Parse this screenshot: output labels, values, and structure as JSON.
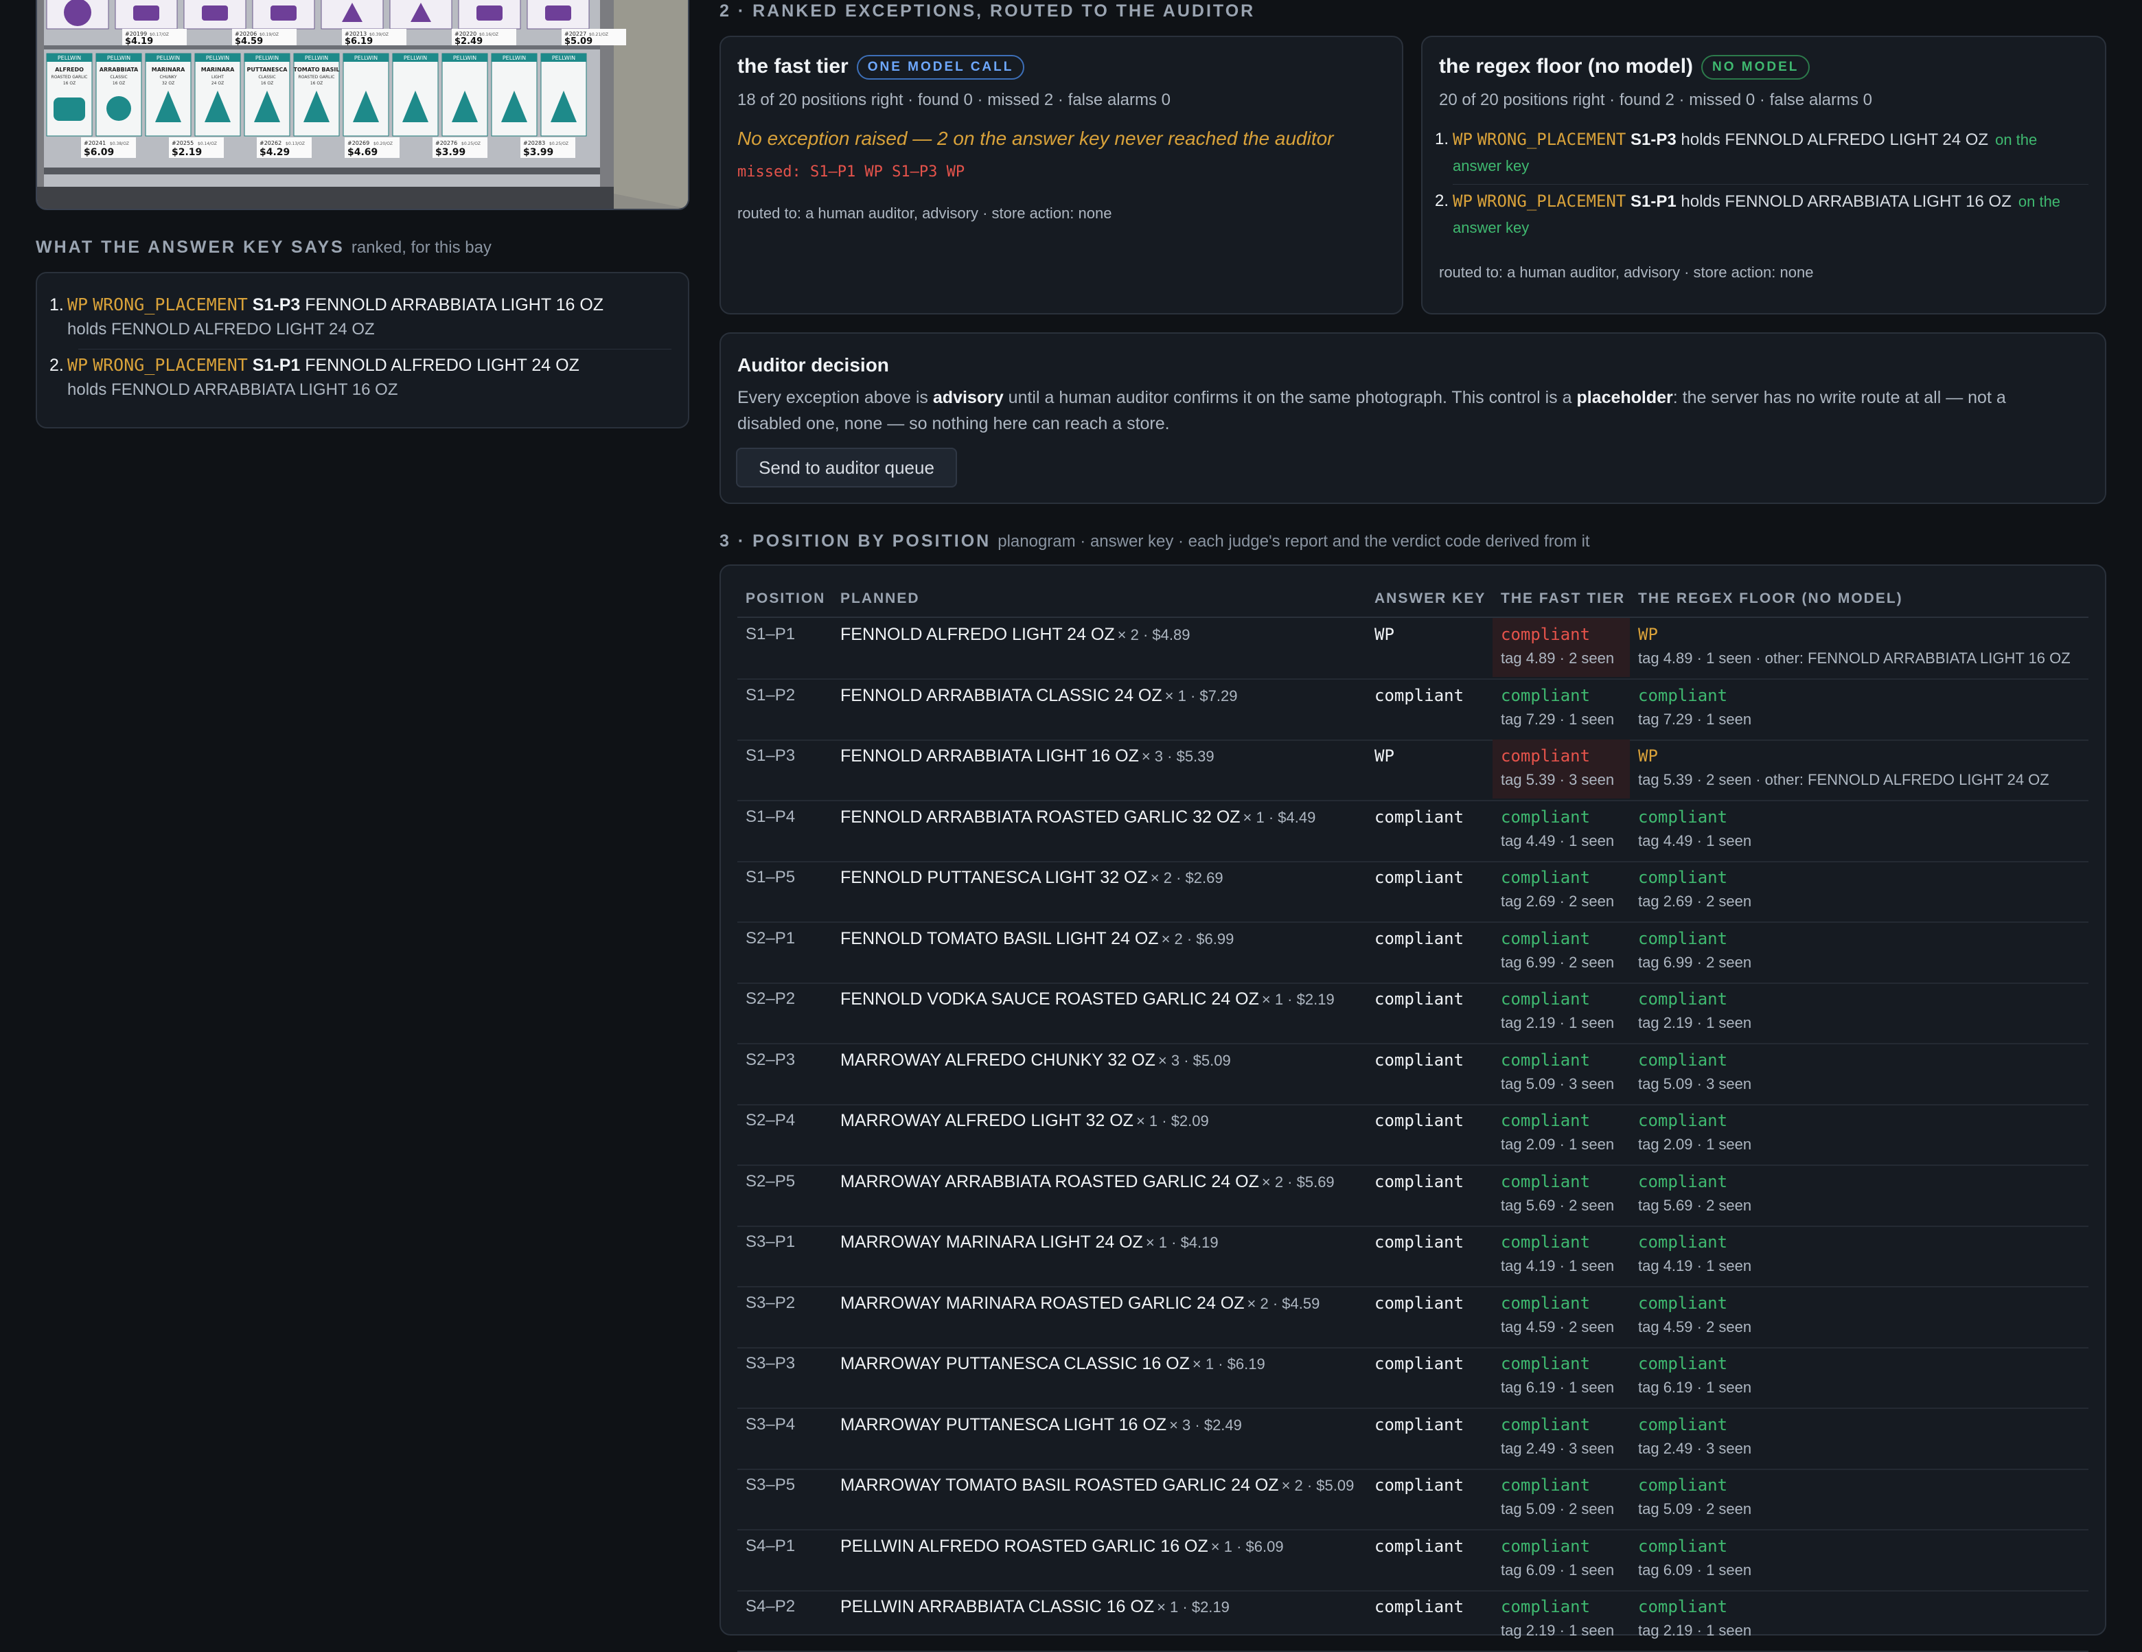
{
  "answer_key": {
    "title": "WHAT THE ANSWER KEY SAYS",
    "subtitle": "ranked, for this bay",
    "items": [
      {
        "n": "1.",
        "code": "WP",
        "label": "WRONG_PLACEMENT",
        "pos": "S1-P3",
        "product": "FENNOLD ARRABBIATA LIGHT 16 OZ",
        "holds": "holds FENNOLD ALFREDO LIGHT 24 OZ"
      },
      {
        "n": "2.",
        "code": "WP",
        "label": "WRONG_PLACEMENT",
        "pos": "S1-P1",
        "product": "FENNOLD ALFREDO LIGHT 24 OZ",
        "holds": "holds FENNOLD ARRABBIATA LIGHT 16 OZ"
      }
    ]
  },
  "exceptions": {
    "title": "2 · RANKED EXCEPTIONS, ROUTED TO THE AUDITOR",
    "fast": {
      "title": "the fast tier",
      "badge": "ONE MODEL CALL",
      "stats": "18 of 20 positions right · found 0 · missed 2 · false alarms 0",
      "message": "No exception raised — 2 on the answer key never reached the auditor",
      "missed": "missed: S1–P1 WP S1–P3 WP",
      "routed": "routed to: a human auditor, advisory · store action: none"
    },
    "regex": {
      "title": "the regex floor (no model)",
      "badge": "NO MODEL",
      "stats": "20 of 20 positions right · found 2 · missed 0 · false alarms 0",
      "items": [
        {
          "n": "1.",
          "code": "WP",
          "label": "WRONG_PLACEMENT",
          "pos": "S1-P3",
          "text": "holds FENNOLD ALFREDO LIGHT 24 OZ",
          "ok_a": "on the",
          "ok_b": "answer key"
        },
        {
          "n": "2.",
          "code": "WP",
          "label": "WRONG_PLACEMENT",
          "pos": "S1-P1",
          "text": "holds FENNOLD ARRABBIATA LIGHT 16 OZ",
          "ok_a": "on the",
          "ok_b": "answer key"
        }
      ],
      "routed": "routed to: a human auditor, advisory · store action: none"
    }
  },
  "auditor": {
    "title": "Auditor decision",
    "p1": "Every exception above is ",
    "b1": "advisory",
    "p2": " until a human auditor confirms it on the same photograph. This control is a ",
    "b2": "placeholder",
    "p3": ": the server has no write route at all — not a",
    "p4": "disabled one, none — so nothing here can reach a store.",
    "button": "Send to auditor queue"
  },
  "table": {
    "title": "3 · POSITION BY POSITION",
    "subtitle": "planogram · answer key · each judge's report and the verdict code derived from it",
    "headers": [
      "POSITION",
      "PLANNED",
      "ANSWER KEY",
      "THE FAST TIER",
      "THE REGEX FLOOR (NO MODEL)"
    ],
    "rows": [
      {
        "pos": "S1–P1",
        "plan": "FENNOLD ALFREDO LIGHT 24 OZ",
        "meta": "× 2 · $4.89",
        "key": "WP",
        "fast": "compliant",
        "fast_tag": "tag 4.89 · 2 seen",
        "fast_bad": true,
        "regex": "WP",
        "regex_tag": "tag 4.89 · 1 seen · other: FENNOLD ARRABBIATA LIGHT 16 OZ",
        "regex_flag": true
      },
      {
        "pos": "S1–P2",
        "plan": "FENNOLD ARRABBIATA CLASSIC 24 OZ",
        "meta": "× 1 · $7.29",
        "key": "compliant",
        "fast": "compliant",
        "fast_tag": "tag 7.29 · 1 seen",
        "regex": "compliant",
        "regex_tag": "tag 7.29 · 1 seen"
      },
      {
        "pos": "S1–P3",
        "plan": "FENNOLD ARRABBIATA LIGHT 16 OZ",
        "meta": "× 3 · $5.39",
        "key": "WP",
        "fast": "compliant",
        "fast_tag": "tag 5.39 · 3 seen",
        "fast_bad": true,
        "regex": "WP",
        "regex_tag": "tag 5.39 · 2 seen · other: FENNOLD ALFREDO LIGHT 24 OZ",
        "regex_flag": true
      },
      {
        "pos": "S1–P4",
        "plan": "FENNOLD ARRABBIATA ROASTED GARLIC 32 OZ",
        "meta": "× 1 · $4.49",
        "key": "compliant",
        "fast": "compliant",
        "fast_tag": "tag 4.49 · 1 seen",
        "regex": "compliant",
        "regex_tag": "tag 4.49 · 1 seen"
      },
      {
        "pos": "S1–P5",
        "plan": "FENNOLD PUTTANESCA LIGHT 32 OZ",
        "meta": "× 2 · $2.69",
        "key": "compliant",
        "fast": "compliant",
        "fast_tag": "tag 2.69 · 2 seen",
        "regex": "compliant",
        "regex_tag": "tag 2.69 · 2 seen"
      },
      {
        "pos": "S2–P1",
        "plan": "FENNOLD TOMATO BASIL LIGHT 24 OZ",
        "meta": "× 2 · $6.99",
        "key": "compliant",
        "fast": "compliant",
        "fast_tag": "tag 6.99 · 2 seen",
        "regex": "compliant",
        "regex_tag": "tag 6.99 · 2 seen"
      },
      {
        "pos": "S2–P2",
        "plan": "FENNOLD VODKA SAUCE ROASTED GARLIC 24 OZ",
        "meta": "× 1 · $2.19",
        "key": "compliant",
        "fast": "compliant",
        "fast_tag": "tag 2.19 · 1 seen",
        "regex": "compliant",
        "regex_tag": "tag 2.19 · 1 seen"
      },
      {
        "pos": "S2–P3",
        "plan": "MARROWAY ALFREDO CHUNKY 32 OZ",
        "meta": "× 3 · $5.09",
        "key": "compliant",
        "fast": "compliant",
        "fast_tag": "tag 5.09 · 3 seen",
        "regex": "compliant",
        "regex_tag": "tag 5.09 · 3 seen"
      },
      {
        "pos": "S2–P4",
        "plan": "MARROWAY ALFREDO LIGHT 32 OZ",
        "meta": "× 1 · $2.09",
        "key": "compliant",
        "fast": "compliant",
        "fast_tag": "tag 2.09 · 1 seen",
        "regex": "compliant",
        "regex_tag": "tag 2.09 · 1 seen"
      },
      {
        "pos": "S2–P5",
        "plan": "MARROWAY ARRABBIATA ROASTED GARLIC 24 OZ",
        "meta": "× 2 · $5.69",
        "key": "compliant",
        "fast": "compliant",
        "fast_tag": "tag 5.69 · 2 seen",
        "regex": "compliant",
        "regex_tag": "tag 5.69 · 2 seen"
      },
      {
        "pos": "S3–P1",
        "plan": "MARROWAY MARINARA LIGHT 24 OZ",
        "meta": "× 1 · $4.19",
        "key": "compliant",
        "fast": "compliant",
        "fast_tag": "tag 4.19 · 1 seen",
        "regex": "compliant",
        "regex_tag": "tag 4.19 · 1 seen"
      },
      {
        "pos": "S3–P2",
        "plan": "MARROWAY MARINARA ROASTED GARLIC 24 OZ",
        "meta": "× 2 · $4.59",
        "key": "compliant",
        "fast": "compliant",
        "fast_tag": "tag 4.59 · 2 seen",
        "regex": "compliant",
        "regex_tag": "tag 4.59 · 2 seen"
      },
      {
        "pos": "S3–P3",
        "plan": "MARROWAY PUTTANESCA CLASSIC 16 OZ",
        "meta": "× 1 · $6.19",
        "key": "compliant",
        "fast": "compliant",
        "fast_tag": "tag 6.19 · 1 seen",
        "regex": "compliant",
        "regex_tag": "tag 6.19 · 1 seen"
      },
      {
        "pos": "S3–P4",
        "plan": "MARROWAY PUTTANESCA LIGHT 16 OZ",
        "meta": "× 3 · $2.49",
        "key": "compliant",
        "fast": "compliant",
        "fast_tag": "tag 2.49 · 3 seen",
        "regex": "compliant",
        "regex_tag": "tag 2.49 · 3 seen"
      },
      {
        "pos": "S3–P5",
        "plan": "MARROWAY TOMATO BASIL ROASTED GARLIC 24 OZ",
        "meta": "× 2 · $5.09",
        "key": "compliant",
        "fast": "compliant",
        "fast_tag": "tag 5.09 · 2 seen",
        "regex": "compliant",
        "regex_tag": "tag 5.09 · 2 seen"
      },
      {
        "pos": "S4–P1",
        "plan": "PELLWIN ALFREDO ROASTED GARLIC 16 OZ",
        "meta": "× 1 · $6.09",
        "key": "compliant",
        "fast": "compliant",
        "fast_tag": "tag 6.09 · 1 seen",
        "regex": "compliant",
        "regex_tag": "tag 6.09 · 1 seen"
      },
      {
        "pos": "S4–P2",
        "plan": "PELLWIN ARRABBIATA CLASSIC 16 OZ",
        "meta": "× 1 · $2.19",
        "key": "compliant",
        "fast": "compliant",
        "fast_tag": "tag 2.19 · 1 seen",
        "regex": "compliant",
        "regex_tag": "tag 2.19 · 1 seen"
      }
    ]
  },
  "photo": {
    "shelf_top": [
      {
        "tag": "#20199",
        "price": "$4.19",
        "unit": "$0.17/OZ"
      },
      {
        "tag": "#20206",
        "price": "$4.59",
        "unit": "$0.19/OZ"
      },
      {
        "tag": "#20213",
        "price": "$6.19",
        "unit": "$0.39/OZ"
      },
      {
        "tag": "#20220",
        "price": "$2.49",
        "unit": "$0.16/OZ"
      },
      {
        "tag": "#20227",
        "price": "$5.09",
        "unit": "$0.21/OZ"
      }
    ],
    "shelf_bottom": [
      {
        "brand": "PELLWIN",
        "name": "ALFREDO",
        "sub": "ROASTED GARLIC",
        "size": "16 OZ",
        "tag": "#20241",
        "price": "$6.09",
        "unit": "$0.38/OZ"
      },
      {
        "brand": "PELLWIN",
        "name": "ARRABBIATA",
        "sub": "CLASSIC",
        "size": "16 OZ",
        "tag": "#20255",
        "price": "$2.19",
        "unit": "$0.14/OZ"
      },
      {
        "brand": "PELLWIN",
        "name": "MARINARA",
        "sub": "CHUNKY",
        "size": "32 OZ",
        "tag": "#20262",
        "price": "$4.29",
        "unit": "$0.13/OZ"
      },
      {
        "brand": "PELLWIN",
        "name": "MARINARA",
        "sub": "LIGHT",
        "size": "24 OZ",
        "tag": "#20269",
        "price": "$4.69",
        "unit": "$0.20/OZ"
      },
      {
        "brand": "PELLWIN",
        "name": "PUTTANESCA",
        "sub": "CLASSIC",
        "size": "16 OZ",
        "tag": "#20276",
        "price": "$3.99",
        "unit": "$0.25/OZ"
      },
      {
        "brand": "PELLWIN",
        "name": "TOMATO BASIL",
        "sub": "ROASTED GARLIC",
        "size": "16 OZ",
        "tag": "#20283",
        "price": "$3.99",
        "unit": "$0.25/OZ"
      }
    ]
  }
}
